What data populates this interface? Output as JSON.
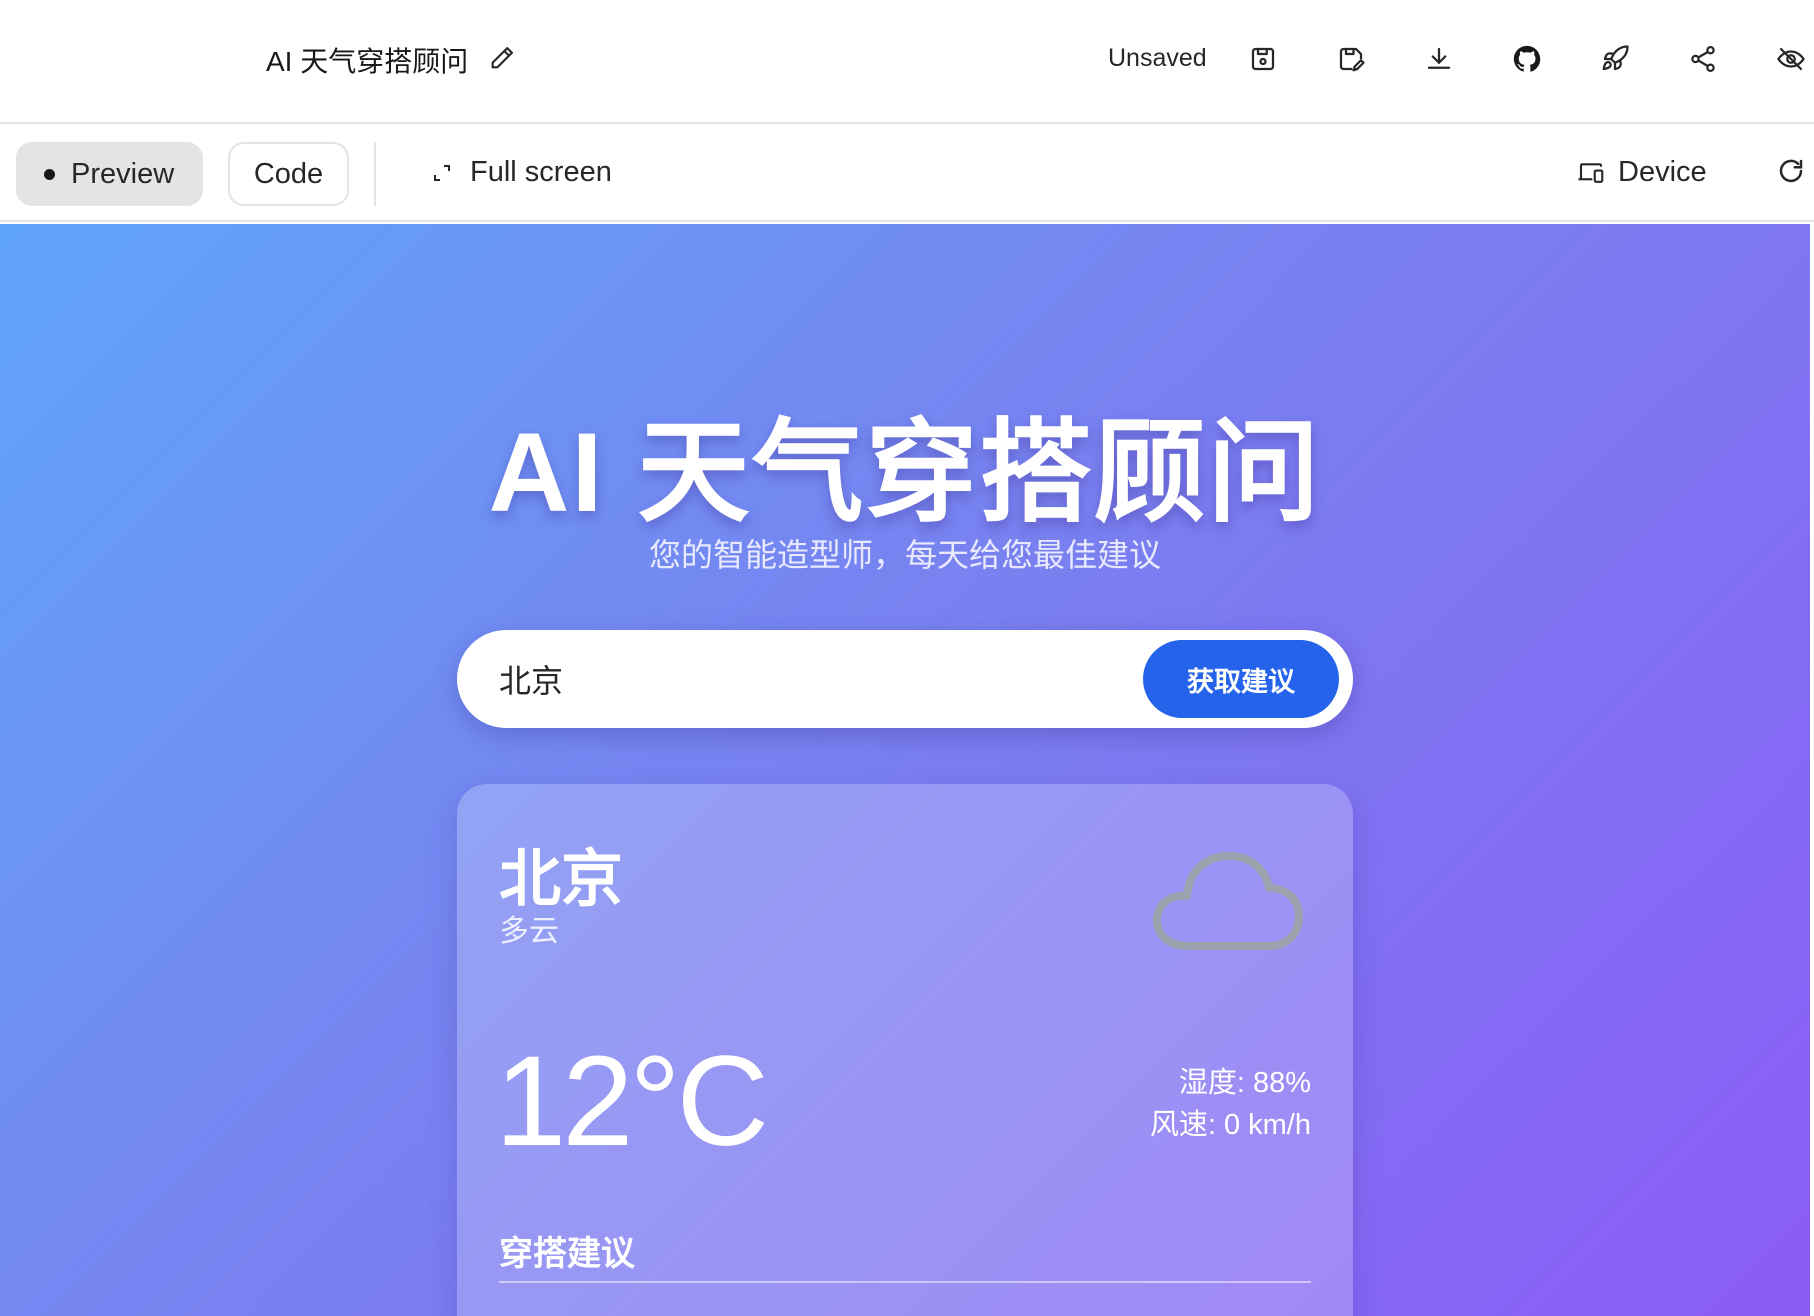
{
  "header": {
    "project_title": "AI 天气穿搭顾问",
    "save_status": "Unsaved",
    "icons": [
      "pencil-icon",
      "save-icon",
      "save-as-icon",
      "download-icon",
      "github-icon",
      "rocket-icon",
      "share-icon",
      "hide-icon"
    ]
  },
  "toolbar": {
    "preview_label": "Preview",
    "code_label": "Code",
    "fullscreen_label": "Full screen",
    "device_label": "Device"
  },
  "app": {
    "title": "AI 天气穿搭顾问",
    "subtitle": "您的智能造型师，每天给您最佳建议",
    "search": {
      "value": "北京",
      "button_label": "获取建议"
    },
    "weather": {
      "city": "北京",
      "condition": "多云",
      "temperature": "12°C",
      "humidity": "湿度: 88%",
      "wind": "风速: 0 km/h",
      "icon": "cloud-icon"
    },
    "advice": {
      "title": "穿搭建议",
      "text": ""
    }
  },
  "colors": {
    "accent": "#2563eb",
    "gradient_start": "#60a5fa",
    "gradient_end": "#8b5cf6"
  }
}
